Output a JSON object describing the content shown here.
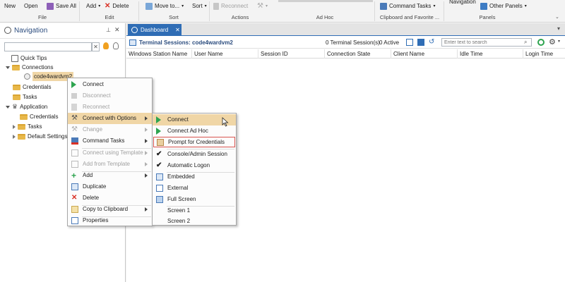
{
  "ribbon": {
    "new": "New",
    "open": "Open",
    "save_all": "Save All",
    "add": "Add",
    "delete": "Delete",
    "move_to": "Move to...",
    "sort": "Sort",
    "reconnect": "Reconnect",
    "command_tasks": "Command Tasks",
    "navigation": "Navigation",
    "other_panels": "Other Panels",
    "groups": [
      "File",
      "Edit",
      "Sort",
      "Actions",
      "Ad Hoc",
      "Clipboard and Favorite ...",
      "Panels"
    ]
  },
  "nav": {
    "title": "Navigation",
    "tree": {
      "quick_tips": "Quick Tips",
      "connections": "Connections",
      "selected_connection": "code4wardvm2",
      "credentials": "Credentials",
      "tasks": "Tasks",
      "application": "Application",
      "app_credentials": "Credentials",
      "app_tasks": "Tasks",
      "default_settings": "Default Settings"
    }
  },
  "main": {
    "tab_label": "Dashboard",
    "terminal_title": "Terminal Sessions:  code4wardvm2",
    "sessions_count": "0 Terminal Session(s)",
    "active_count": "0 Active",
    "filter_placeholder": "Enter text to search",
    "columns": [
      "Windows Station Name",
      "User Name",
      "Session ID",
      "Connection State",
      "Client Name",
      "Idle Time",
      "Login Time"
    ]
  },
  "context_menu": {
    "connect": "Connect",
    "disconnect": "Disconnect",
    "reconnect": "Reconnect",
    "connect_with_options": "Connect with Options",
    "change": "Change",
    "command_tasks": "Command Tasks",
    "connect_using_template": "Connect using Template",
    "add_from_template": "Add from Template",
    "add": "Add",
    "duplicate": "Duplicate",
    "delete": "Delete",
    "copy_to_clipboard": "Copy to Clipboard",
    "properties": "Properties"
  },
  "submenu": {
    "connect": "Connect",
    "connect_ad_hoc": "Connect Ad Hoc",
    "prompt_for_credentials": "Prompt for Credentials",
    "console_admin_session": "Console/Admin Session",
    "automatic_logon": "Automatic Logon",
    "embedded": "Embedded",
    "external": "External",
    "full_screen": "Full Screen",
    "screen_1": "Screen 1",
    "screen_2": "Screen 2"
  },
  "colors": {
    "accent": "#2f6db5",
    "highlight": "#f0d6a6",
    "callout": "#d9534f",
    "play_green": "#2ea44f",
    "delete_red": "#d93025"
  },
  "icons": [
    "save-icon",
    "delete-icon",
    "move-icon",
    "reconnect-icon",
    "command-tasks-icon",
    "other-panels-icon",
    "navigation-icon",
    "pin-icon",
    "close-icon",
    "lightbulb-icon",
    "refresh-icon",
    "gear-icon",
    "play-icon",
    "check-icon"
  ]
}
